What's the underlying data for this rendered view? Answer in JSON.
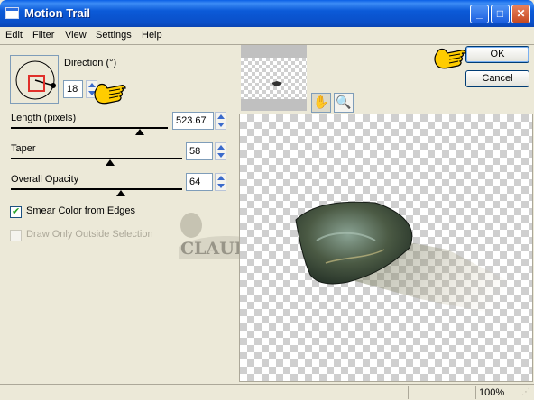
{
  "window": {
    "title": "Motion Trail"
  },
  "title_buttons": {
    "minimize": "_",
    "maximize": "□",
    "close": "✕"
  },
  "menu": [
    "Edit",
    "Filter",
    "View",
    "Settings",
    "Help"
  ],
  "direction": {
    "label": "Direction (°)",
    "value": "18"
  },
  "length": {
    "label": "Length (pixels)",
    "value": "523.67",
    "slider_fraction": 0.62
  },
  "taper": {
    "label": "Taper",
    "value": "58",
    "slider_fraction": 0.58
  },
  "opacity": {
    "label": "Overall Opacity",
    "value": "64",
    "slider_fraction": 0.64
  },
  "smear": {
    "label": "Smear Color from Edges",
    "checked": true
  },
  "draw_only": {
    "label": "Draw Only Outside Selection",
    "checked": false,
    "disabled": true
  },
  "watermark": {
    "text": "CLAUDIA"
  },
  "buttons": {
    "ok": "OK",
    "cancel": "Cancel"
  },
  "icons": {
    "pan": "hand-pan-icon",
    "zoom": "magnifier-icon",
    "pointer": "pointing-hand-icon"
  },
  "status": {
    "zoom": "100%"
  },
  "colors": {
    "titlebar": "#0a5fe6",
    "accent": "#ffcc00",
    "thumb_marker": "#e0302a"
  }
}
